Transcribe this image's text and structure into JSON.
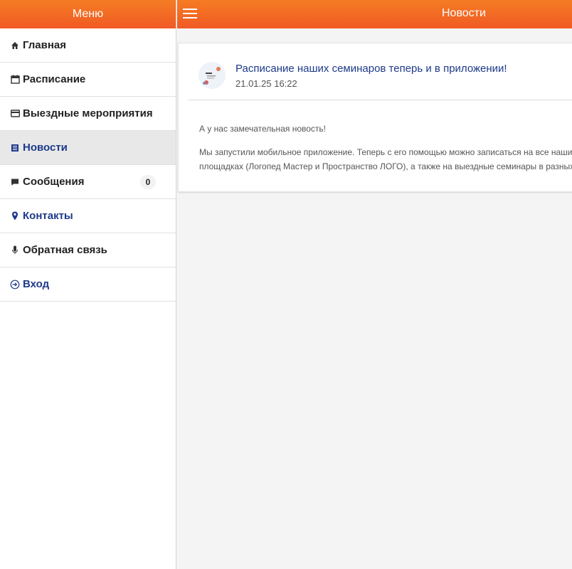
{
  "sidebar": {
    "title": "Меню",
    "items": [
      {
        "label": "Главная",
        "icon": "home-icon"
      },
      {
        "label": "Расписание",
        "icon": "calendar-icon"
      },
      {
        "label": "Выездные мероприятия",
        "icon": "card-icon"
      },
      {
        "label": "Новости",
        "icon": "list-icon",
        "active": true
      },
      {
        "label": "Сообщения",
        "icon": "message-icon",
        "badge": "0"
      },
      {
        "label": "Контакты",
        "icon": "map-pin-icon"
      },
      {
        "label": "Обратная связь",
        "icon": "microphone-icon"
      },
      {
        "label": "Вход",
        "icon": "sign-in-icon"
      }
    ]
  },
  "header": {
    "title": "Новости"
  },
  "news": {
    "title": "Расписание наших семинаров теперь и в приложении!",
    "date": "21.01.25 16:22",
    "paragraphs": [
      "А у нас замечательная новость!",
      "Мы запустили мобильное приложение. Теперь с его помощью можно записаться на все наши семинары на",
      "площадках (Логопед Мастер и Пространство ЛОГО), а также на выездные семинары в разных городах."
    ]
  },
  "colors": {
    "accent": "#f15a24",
    "link": "#1d3a8a",
    "active_bg": "#e8e8e8"
  }
}
